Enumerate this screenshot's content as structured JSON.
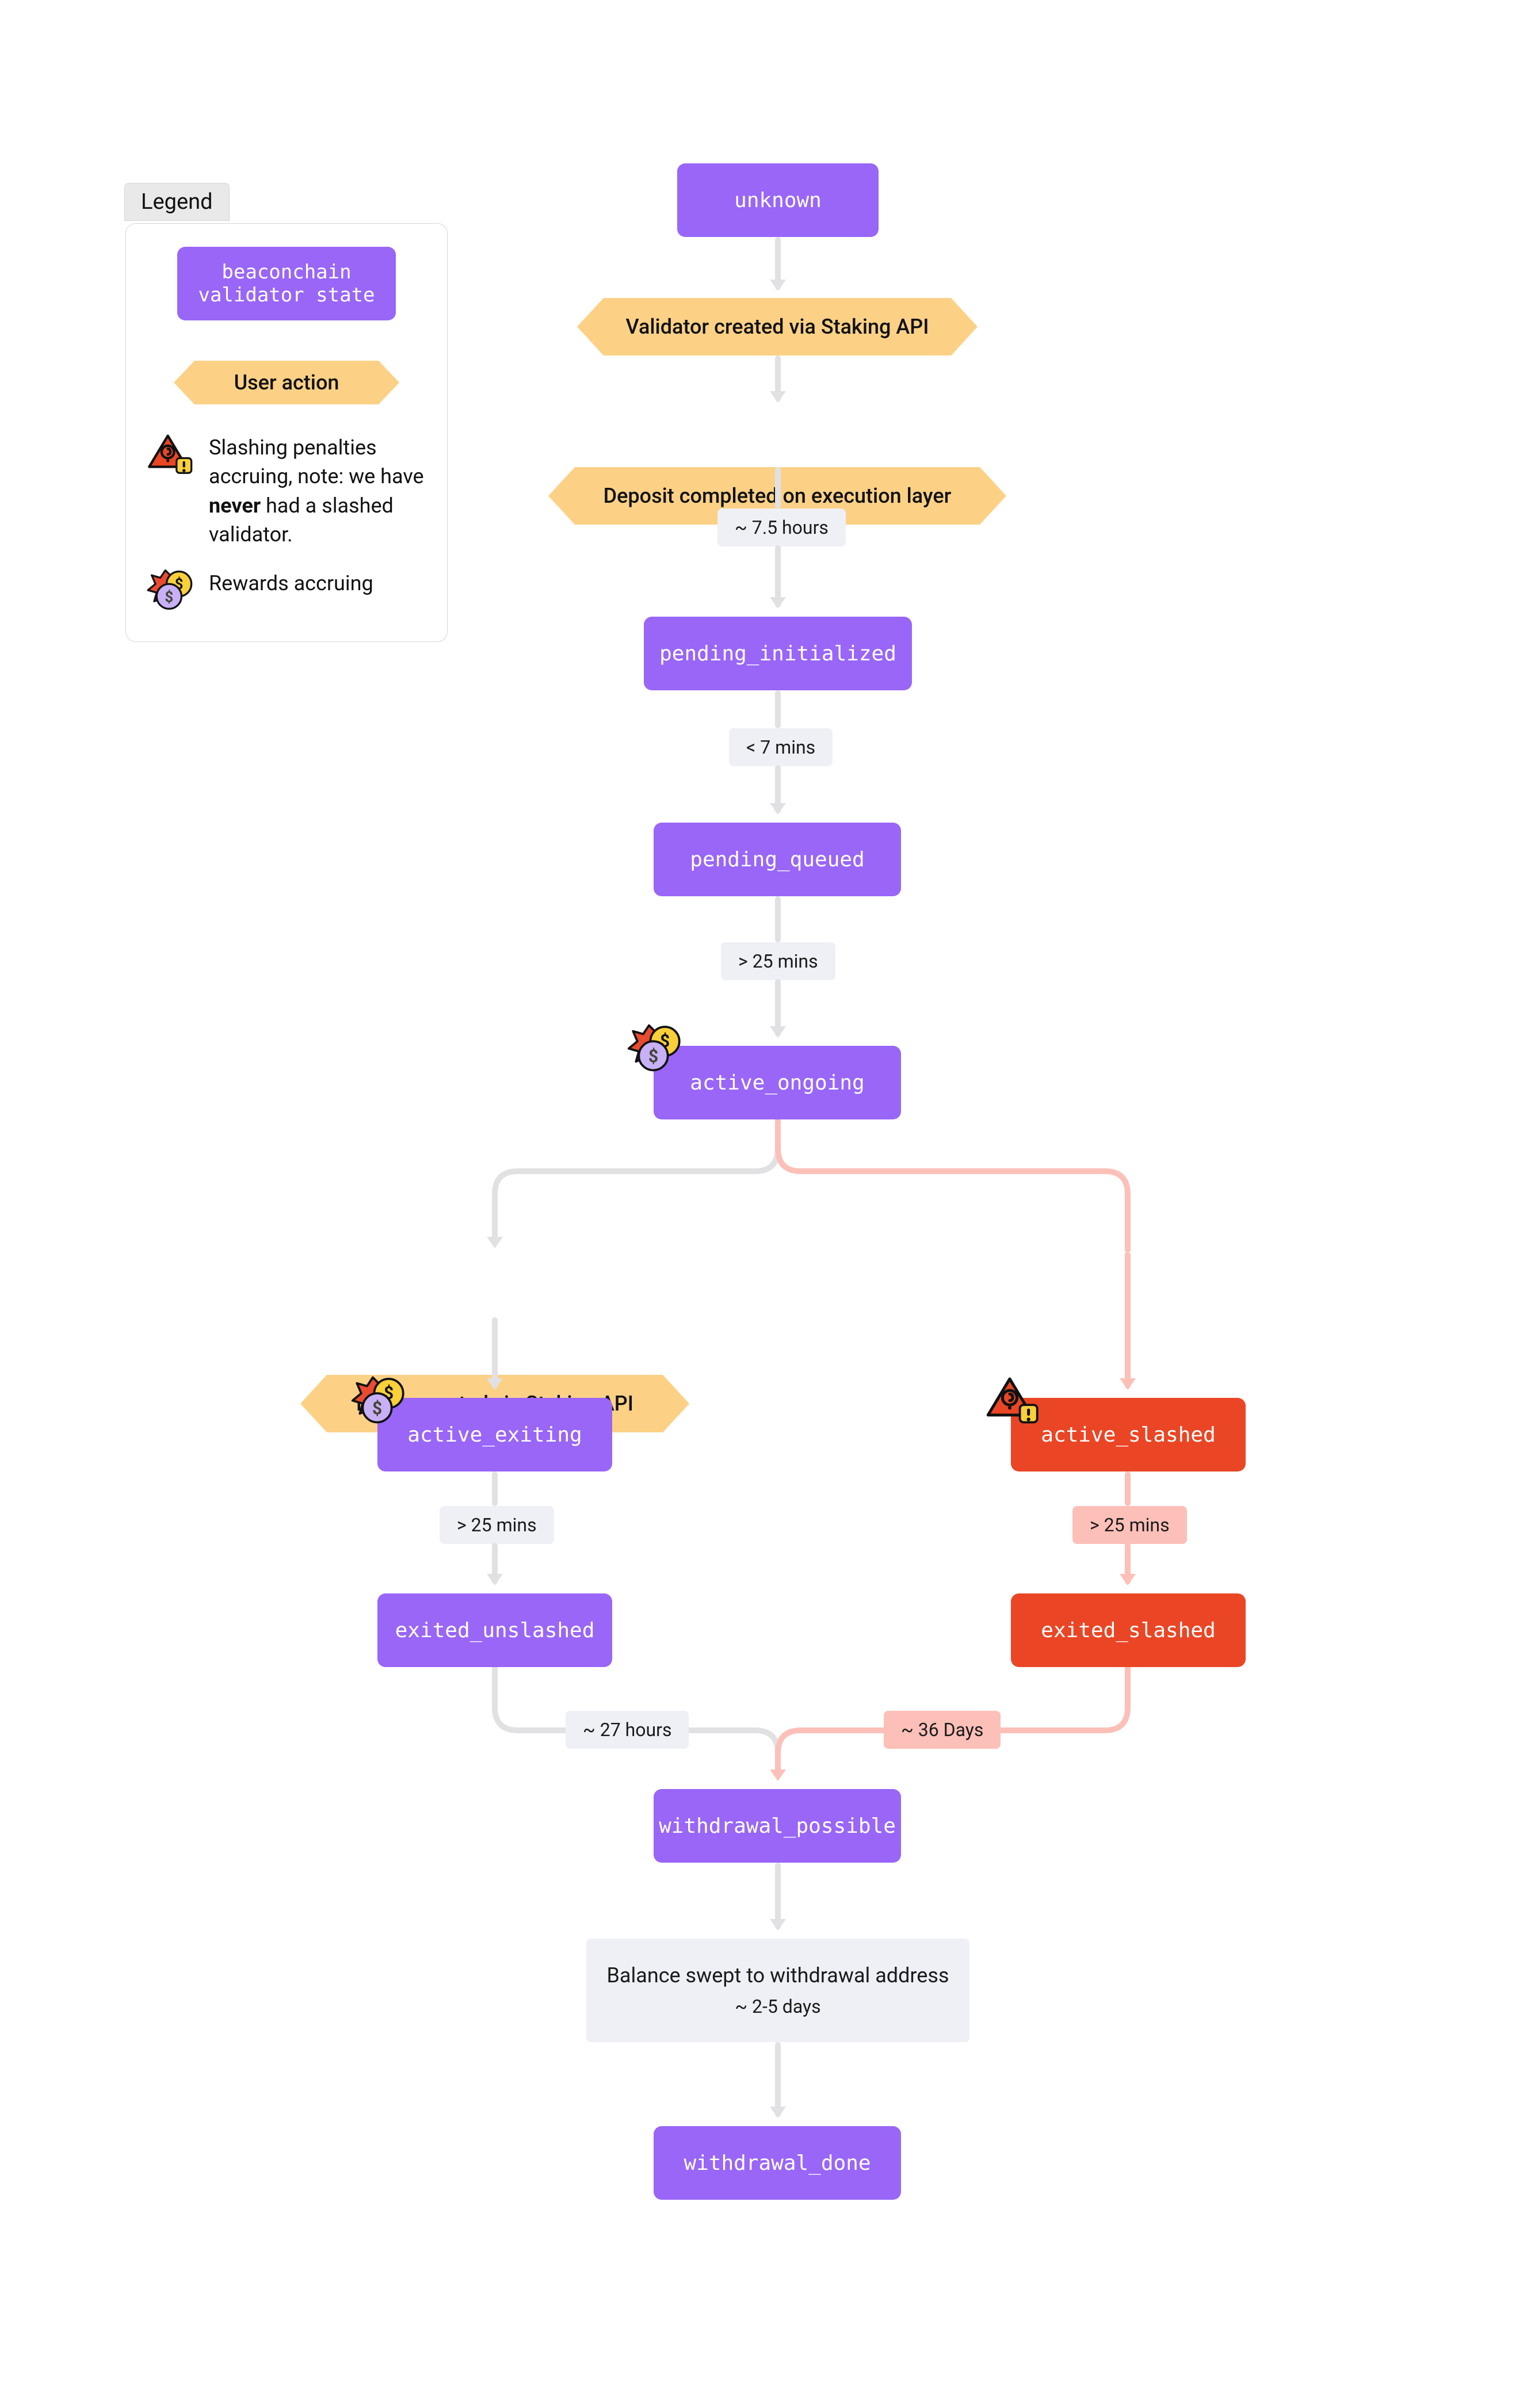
{
  "legend": {
    "tab": "Legend",
    "state_example": "beaconchain validator state",
    "user_action_example": "User action",
    "slashing_note_prefix": "Slashing penalties accruing, note: we have ",
    "slashing_note_bold": "never",
    "slashing_note_suffix": " had a slashed validator.",
    "rewards_note": "Rewards accruing"
  },
  "states": {
    "unknown": "unknown",
    "pending_initialized": "pending_initialized",
    "pending_queued": "pending_queued",
    "active_ongoing": "active_ongoing",
    "active_exiting": "active_exiting",
    "active_slashed": "active_slashed",
    "exited_unslashed": "exited_unslashed",
    "exited_slashed": "exited_slashed",
    "withdrawal_possible": "withdrawal_possible",
    "withdrawal_done": "withdrawal_done"
  },
  "actions": {
    "create": "Validator created via Staking API",
    "deposit": "Deposit completed on execution layer",
    "exit": "Exit requested via Staking API"
  },
  "times": {
    "t_7_5h": "~ 7.5 hours",
    "t_lt7m": "< 7 mins",
    "t_gt25m_1": ">  25 mins",
    "t_gt25m_2": ">  25 mins",
    "t_gt25m_3": ">  25 mins",
    "t_27h": "~  27 hours",
    "t_36d": "~  36 Days"
  },
  "info": {
    "sweep_title": "Balance swept to withdrawal address",
    "sweep_sub": "~ 2-5 days"
  }
}
